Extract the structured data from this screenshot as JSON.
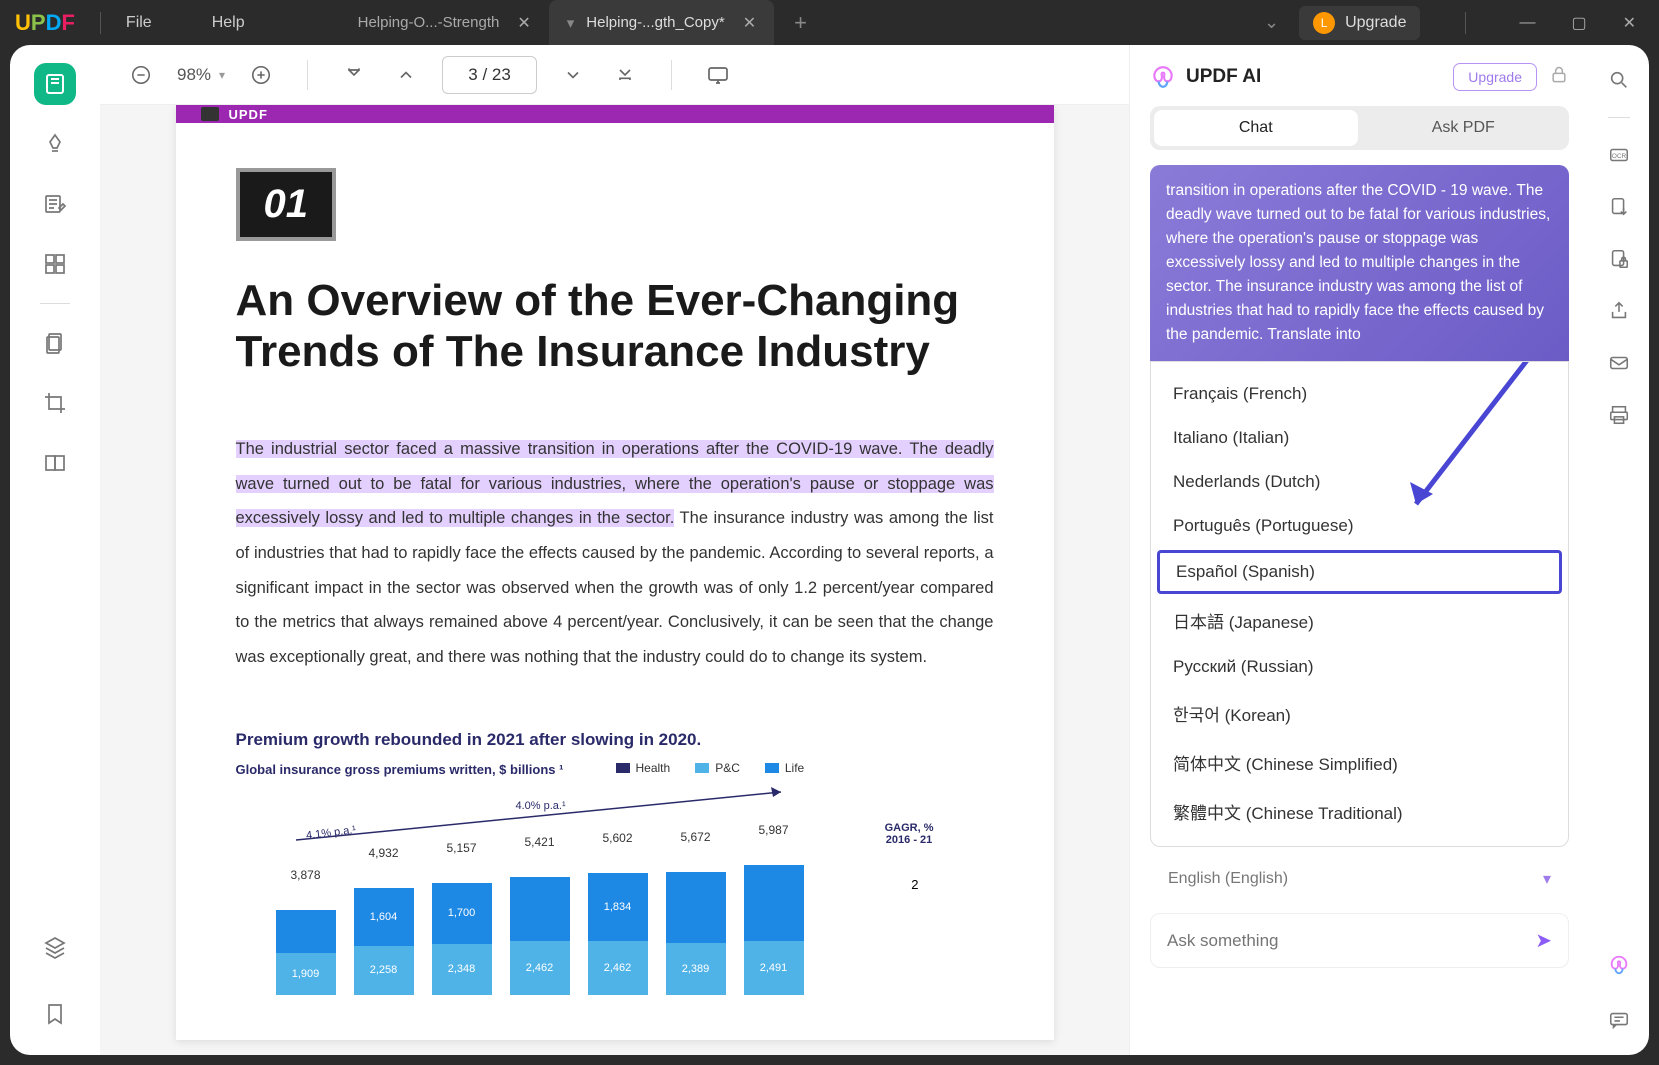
{
  "app": {
    "name": "UPDF"
  },
  "menu": {
    "file": "File",
    "help": "Help"
  },
  "tabs": {
    "tab1": "Helping-O...-Strength",
    "tab2": "Helping-...gth_Copy*"
  },
  "window": {
    "upgrade": "Upgrade",
    "avatar_letter": "L"
  },
  "toolbar": {
    "zoom_pct": "98%",
    "page_display": "3  /  23"
  },
  "document": {
    "banner_brand": "UPDF",
    "chapter_number": "01",
    "title": "An Overview of the Ever-Changing Trends of The Insurance Industry",
    "body_highlighted": "The industrial sector faced a massive transition in operations after the COVID-19 wave. The deadly wave turned out to be fatal for various industries, where the operation's pause or stoppage was excessively lossy and led to multiple changes in the sector.",
    "body_rest": " The insurance industry was among the list of industries that had to rapidly face the effects caused by the pandemic. According to several reports, a significant impact in the sector was observed when the growth was of only 1.2 percent/year compared to the metrics that always remained above 4 percent/year. Conclusively, it can be seen that the change was exceptionally great, and there was nothing that the industry could do to change its system."
  },
  "chart_data": {
    "type": "bar",
    "title": "Premium growth rebounded in 2021 after slowing in 2020.",
    "subtitle": "Global insurance gross premiums written, $ billions ¹",
    "legend": [
      "Health",
      "P&C",
      "Life"
    ],
    "series": [
      {
        "name": "Health",
        "color": "#2a2a6a",
        "values": [
          null,
          null,
          null,
          null,
          null,
          null,
          null
        ]
      },
      {
        "name": "P&C",
        "color": "#4fb3e8",
        "values": [
          1909,
          2258,
          2348,
          2462,
          2462,
          2389,
          2491
        ]
      },
      {
        "name": "Life",
        "color": "#1e88e5",
        "values": [
          null,
          1604,
          1700,
          null,
          1834,
          null,
          null
        ]
      }
    ],
    "totals": [
      3878,
      4932,
      5157,
      5421,
      5602,
      5672,
      5987
    ],
    "gagr_label": "GAGR, %",
    "gagr_period": "2016 - 21",
    "gagr_value": "2",
    "growth_labels": [
      "4.1% p.a.¹",
      "4.0% p.a.¹"
    ]
  },
  "ai": {
    "title": "UPDF AI",
    "upgrade": "Upgrade",
    "tab_chat": "Chat",
    "tab_ask": "Ask PDF",
    "context_text": "transition in operations after the COVID - 19 wave. The deadly wave turned out to be fatal for various industries, where the operation's pause or stoppage was excessively lossy and led to multiple changes in the sector. The insurance industry was among the list of industries that had to rapidly face the effects caused by the pandemic. Translate into",
    "languages": {
      "french": "Français (French)",
      "italian": "Italiano (Italian)",
      "dutch": "Nederlands (Dutch)",
      "portuguese": "Português (Portuguese)",
      "spanish": "Español (Spanish)",
      "japanese": "日本語 (Japanese)",
      "russian": "Русский (Russian)",
      "korean": "한국어 (Korean)",
      "chinese_s": "简体中文 (Chinese Simplified)",
      "chinese_t": "繁體中文 (Chinese Traditional)"
    },
    "selected_lang": "English (English)",
    "ask_placeholder": "Ask something"
  }
}
